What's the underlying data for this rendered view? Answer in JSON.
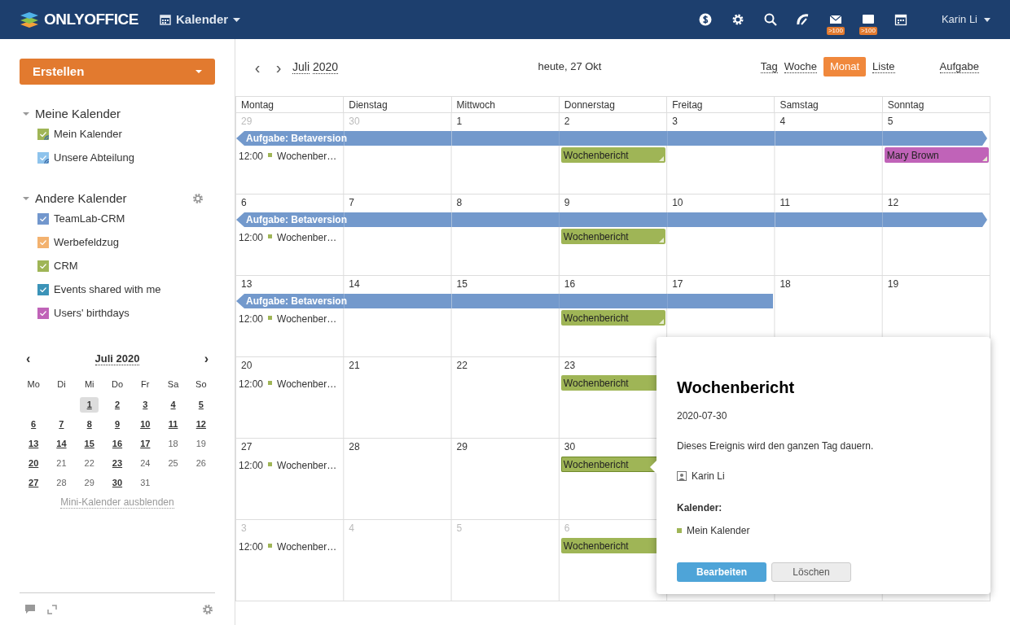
{
  "header": {
    "logo": "ONLYOFFICE",
    "module": "Kalender",
    "badges": [
      {
        "kind": "dollar"
      },
      {
        "kind": "settings"
      },
      {
        "kind": "search"
      },
      {
        "kind": "feed"
      },
      {
        "kind": "mail",
        "count": ">100"
      },
      {
        "kind": "chat",
        "count": ">100"
      },
      {
        "kind": "calendar"
      }
    ],
    "user": "Karin Li"
  },
  "sidebar": {
    "create_button": "Erstellen",
    "groups": [
      {
        "title": "Meine Kalender",
        "expanded": true,
        "has_settings": false,
        "items": [
          {
            "label": "Mein Kalender",
            "color": "#9fb556",
            "checked": true,
            "shared": true
          },
          {
            "label": "Unsere Abteilung",
            "color": "#8ec3ec",
            "checked": true,
            "shared": true
          }
        ]
      },
      {
        "title": "Andere Kalender",
        "expanded": true,
        "has_settings": true,
        "items": [
          {
            "label": "TeamLab-CRM",
            "color": "#7297cd",
            "checked": true,
            "shared": false
          },
          {
            "label": "Werbefeldzug",
            "color": "#f3b26f",
            "checked": true,
            "shared": false
          },
          {
            "label": "CRM",
            "color": "#9fb556",
            "checked": true,
            "shared": false
          },
          {
            "label": "Events shared with me",
            "color": "#3b93b8",
            "checked": true,
            "shared": false
          },
          {
            "label": "Users' birthdays",
            "color": "#c063b8",
            "checked": true,
            "shared": false
          }
        ]
      }
    ],
    "mini_calendar": {
      "prev": "‹",
      "title": "Juli 2020",
      "next": "›",
      "weekdays": [
        "Mo",
        "Di",
        "Mi",
        "Do",
        "Fr",
        "Sa",
        "So"
      ],
      "days": [
        {
          "kind": "blank"
        },
        {
          "kind": "blank"
        },
        {
          "kind": "day",
          "label": "1",
          "has_events": true,
          "selected": true
        },
        {
          "kind": "day",
          "label": "2",
          "has_events": true,
          "selected": false
        },
        {
          "kind": "day",
          "label": "3",
          "has_events": true,
          "selected": false
        },
        {
          "kind": "day",
          "label": "4",
          "has_events": true,
          "selected": false
        },
        {
          "kind": "day",
          "label": "5",
          "has_events": true,
          "selected": false
        },
        {
          "kind": "day",
          "label": "6",
          "has_events": true,
          "selected": false
        },
        {
          "kind": "day",
          "label": "7",
          "has_events": true,
          "selected": false
        },
        {
          "kind": "day",
          "label": "8",
          "has_events": true,
          "selected": false
        },
        {
          "kind": "day",
          "label": "9",
          "has_events": true,
          "selected": false
        },
        {
          "kind": "day",
          "label": "10",
          "has_events": true,
          "selected": false
        },
        {
          "kind": "day",
          "label": "11",
          "has_events": true,
          "selected": false
        },
        {
          "kind": "day",
          "label": "12",
          "has_events": true,
          "selected": false
        },
        {
          "kind": "day",
          "label": "13",
          "has_events": true,
          "selected": false
        },
        {
          "kind": "day",
          "label": "14",
          "has_events": true,
          "selected": false
        },
        {
          "kind": "day",
          "label": "15",
          "has_events": true,
          "selected": false
        },
        {
          "kind": "day",
          "label": "16",
          "has_events": true,
          "selected": false
        },
        {
          "kind": "day",
          "label": "17",
          "has_events": true,
          "selected": false
        },
        {
          "kind": "day",
          "label": "18",
          "has_events": false,
          "selected": false
        },
        {
          "kind": "day",
          "label": "19",
          "has_events": false,
          "selected": false
        },
        {
          "kind": "day",
          "label": "20",
          "has_events": true,
          "selected": false
        },
        {
          "kind": "day",
          "label": "21",
          "has_events": false,
          "selected": false
        },
        {
          "kind": "day",
          "label": "22",
          "has_events": false,
          "selected": false
        },
        {
          "kind": "day",
          "label": "23",
          "has_events": true,
          "selected": false
        },
        {
          "kind": "day",
          "label": "24",
          "has_events": false,
          "selected": false
        },
        {
          "kind": "day",
          "label": "25",
          "has_events": false,
          "selected": false
        },
        {
          "kind": "day",
          "label": "26",
          "has_events": false,
          "selected": false
        },
        {
          "kind": "day",
          "label": "27",
          "has_events": true,
          "selected": false
        },
        {
          "kind": "day",
          "label": "28",
          "has_events": false,
          "selected": false
        },
        {
          "kind": "day",
          "label": "29",
          "has_events": false,
          "selected": false
        },
        {
          "kind": "day",
          "label": "30",
          "has_events": true,
          "selected": false
        },
        {
          "kind": "day",
          "label": "31",
          "has_events": false,
          "selected": false
        }
      ],
      "hide_link": "Mini-Kalender ausblenden"
    }
  },
  "toolbar": {
    "prev": "‹",
    "next": "›",
    "month": "Juli",
    "year": "2020",
    "today": "heute, 27 Okt",
    "views": [
      {
        "label": "Tag",
        "selected": false
      },
      {
        "label": "Woche",
        "selected": false
      },
      {
        "label": "Monat",
        "selected": true
      },
      {
        "label": "Liste",
        "selected": false
      }
    ],
    "task_link": "Aufgabe"
  },
  "calendar": {
    "columns": [
      "Montag",
      "Dienstag",
      "Mittwoch",
      "Donnerstag",
      "Freitag",
      "Samstag",
      "Sonntag"
    ],
    "weeks": [
      {
        "task": {
          "title": "Aufgabe: Betaversion",
          "continues_before": true,
          "continues_after": true
        },
        "days": [
          {
            "label": "29",
            "other_month": true,
            "task": true,
            "events": [
              {
                "kind": "timed",
                "time": "12:00",
                "title": "Wochenber…",
                "color": "#9fb556"
              }
            ]
          },
          {
            "label": "30",
            "other_month": true,
            "task": true
          },
          {
            "label": "1",
            "other_month": false,
            "task": true
          },
          {
            "label": "2",
            "other_month": false,
            "task": true,
            "events": [
              {
                "kind": "allday",
                "title": "Wochenbericht",
                "color": "#9fb556",
                "selected": false
              }
            ]
          },
          {
            "label": "3",
            "other_month": false,
            "task": true
          },
          {
            "label": "4",
            "other_month": false,
            "task": true
          },
          {
            "label": "5",
            "other_month": false,
            "task": true,
            "events": [
              {
                "kind": "allday",
                "title": "Mary Brown",
                "color": "#c063b8",
                "selected": false
              }
            ]
          }
        ]
      },
      {
        "task": {
          "title": "Aufgabe: Betaversion",
          "continues_before": true,
          "continues_after": true
        },
        "days": [
          {
            "label": "6",
            "other_month": false,
            "task": true,
            "events": [
              {
                "kind": "timed",
                "time": "12:00",
                "title": "Wochenber…",
                "color": "#9fb556"
              }
            ]
          },
          {
            "label": "7",
            "other_month": false,
            "task": true
          },
          {
            "label": "8",
            "other_month": false,
            "task": true
          },
          {
            "label": "9",
            "other_month": false,
            "task": true,
            "events": [
              {
                "kind": "allday",
                "title": "Wochenbericht",
                "color": "#9fb556",
                "selected": false
              }
            ]
          },
          {
            "label": "10",
            "other_month": false,
            "task": true
          },
          {
            "label": "11",
            "other_month": false,
            "task": true
          },
          {
            "label": "12",
            "other_month": false,
            "task": true
          }
        ]
      },
      {
        "task": {
          "title": "Aufgabe: Betaversion",
          "continues_before": true,
          "continues_after": false
        },
        "days": [
          {
            "label": "13",
            "other_month": false,
            "task": true,
            "events": [
              {
                "kind": "timed",
                "time": "12:00",
                "title": "Wochenber…",
                "color": "#9fb556"
              }
            ]
          },
          {
            "label": "14",
            "other_month": false,
            "task": true
          },
          {
            "label": "15",
            "other_month": false,
            "task": true
          },
          {
            "label": "16",
            "other_month": false,
            "task": true,
            "events": [
              {
                "kind": "allday",
                "title": "Wochenbericht",
                "color": "#9fb556",
                "selected": false
              }
            ]
          },
          {
            "label": "17",
            "other_month": false,
            "task": true
          },
          {
            "label": "18",
            "other_month": false,
            "task": false
          },
          {
            "label": "19",
            "other_month": false,
            "task": false
          }
        ]
      },
      {
        "days": [
          {
            "label": "20",
            "other_month": false,
            "events": [
              {
                "kind": "timed",
                "time": "12:00",
                "title": "Wochenber…",
                "color": "#9fb556"
              }
            ]
          },
          {
            "label": "21",
            "other_month": false
          },
          {
            "label": "22",
            "other_month": false
          },
          {
            "label": "23",
            "other_month": false,
            "events": [
              {
                "kind": "allday",
                "title": "Wochenbericht",
                "color": "#9fb556",
                "selected": false
              }
            ]
          }
        ]
      },
      {
        "days": [
          {
            "label": "27",
            "other_month": false,
            "events": [
              {
                "kind": "timed",
                "time": "12:00",
                "title": "Wochenber…",
                "color": "#9fb556"
              }
            ]
          },
          {
            "label": "28",
            "other_month": false
          },
          {
            "label": "29",
            "other_month": false
          },
          {
            "label": "30",
            "other_month": false,
            "events": [
              {
                "kind": "allday",
                "title": "Wochenbericht",
                "color": "#9fb556",
                "selected": true
              }
            ]
          }
        ]
      },
      {
        "days": [
          {
            "label": "3",
            "other_month": true,
            "events": [
              {
                "kind": "timed",
                "time": "12:00",
                "title": "Wochenber…",
                "color": "#9fb556"
              }
            ]
          },
          {
            "label": "4",
            "other_month": true
          },
          {
            "label": "5",
            "other_month": true
          },
          {
            "label": "6",
            "other_month": true,
            "events": [
              {
                "kind": "allday",
                "title": "Wochenbericht",
                "color": "#9fb556",
                "selected": false
              }
            ]
          }
        ]
      }
    ]
  },
  "popup": {
    "title": "Wochenbericht",
    "date": "2020-07-30",
    "description": "Dieses Ereignis wird den ganzen Tag dauern.",
    "owner": "Karin Li",
    "calendar_label": "Kalender:",
    "calendar": {
      "name": "Mein Kalender",
      "color": "#9fb556"
    },
    "buttons": [
      {
        "kind": "primary",
        "label": "Bearbeiten"
      },
      {
        "kind": "secondary",
        "label": "Löschen"
      }
    ]
  }
}
